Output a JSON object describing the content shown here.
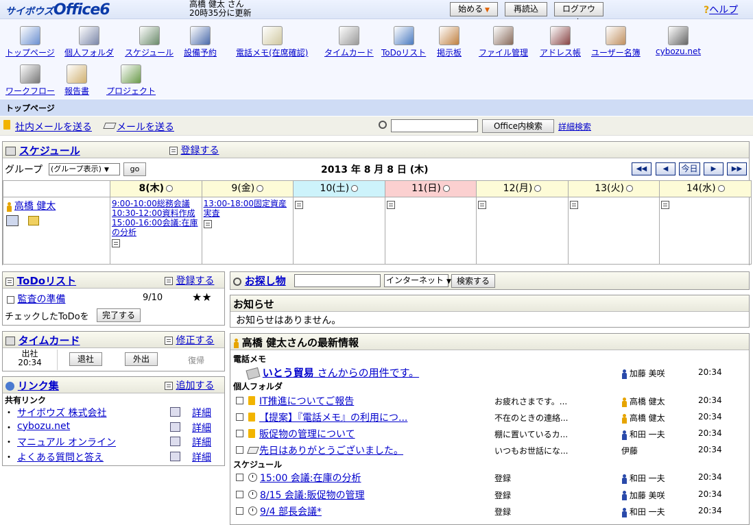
{
  "header": {
    "logo_small": "サイボウズ",
    "logo_big": "Office6",
    "user_name": "高橋 健太 さん",
    "updated": "20時35分に更新",
    "start_btn": "始める",
    "reload_btn": "再読込",
    "logout_btn": "ログアウト",
    "help": "ヘルプ"
  },
  "apps": [
    {
      "label": "トップページ",
      "icon": "top-page-icon"
    },
    {
      "label": "個人フォルダ",
      "icon": "personal-folder-icon"
    },
    {
      "label": "スケジュール",
      "icon": "schedule-icon"
    },
    {
      "label": "設備予約",
      "icon": "facility-icon"
    },
    {
      "label": "電話メモ(在席確認)",
      "icon": "phone-memo-icon"
    },
    {
      "label": "タイムカード",
      "icon": "timecard-icon"
    },
    {
      "label": "ToDoリスト",
      "icon": "todo-icon"
    },
    {
      "label": "掲示板",
      "icon": "bulletin-icon"
    },
    {
      "label": "ファイル管理",
      "icon": "file-management-icon"
    },
    {
      "label": "アドレス帳",
      "icon": "address-book-icon"
    },
    {
      "label": "ユーザー名簿",
      "icon": "user-directory-icon"
    },
    {
      "label": "cybozu.net",
      "icon": "cybozu-net-icon"
    },
    {
      "label": "ワークフロー",
      "icon": "workflow-icon"
    },
    {
      "label": "報告書",
      "icon": "report-icon"
    },
    {
      "label": "プロジェクト",
      "icon": "project-icon"
    }
  ],
  "page_title": "トップページ",
  "toolbar": {
    "internal_mail": "社内メールを送る",
    "send_mail": "メールを送る",
    "search_btn": "Office内検索",
    "detail_search": "詳細検索"
  },
  "schedule": {
    "title": "スケジュール",
    "register": "登録する",
    "group_label": "グループ",
    "group_select": "(グループ表示)",
    "go_btn": "go",
    "date": "2013 年 8 月 8 日 (木)",
    "nav_first": "◀◀",
    "nav_prev": "◀",
    "nav_today": "今日",
    "nav_next": "▶",
    "nav_last": "▶▶",
    "days": [
      {
        "label": "8(木)",
        "bg": "#fdfbd7",
        "bold": true
      },
      {
        "label": "9(金)",
        "bg": "#fdfbd7"
      },
      {
        "label": "10(土)",
        "bg": "#cdf3fb"
      },
      {
        "label": "11(日)",
        "bg": "#fbd0d0"
      },
      {
        "label": "12(月)",
        "bg": "#fdfbd7"
      },
      {
        "label": "13(火)",
        "bg": "#fdfbd7"
      },
      {
        "label": "14(水)",
        "bg": "#fdfbd7"
      }
    ],
    "user": "高橋 健太",
    "events_day1": [
      "9:00-10:00総務会議",
      "10:30-12:00資料作成",
      "15:00-16:00会議:在庫の分析"
    ],
    "events_day2": [
      "13:00-18:00固定資産実査"
    ]
  },
  "todo": {
    "title": "ToDoリスト",
    "register": "登録する",
    "item": "監査の準備",
    "due": "9/10",
    "stars": "★★",
    "checked_label": "チェックしたToDoを",
    "complete_btn": "完了する"
  },
  "timecard": {
    "title": "タイムカード",
    "edit": "修正する",
    "in_label": "出社",
    "in_time": "20:34",
    "out_btn": "退社",
    "away_btn": "外出",
    "return_btn": "復帰"
  },
  "links": {
    "title": "リンク集",
    "add": "追加する",
    "shared": "共有リンク",
    "detail": "詳細",
    "items": [
      "サイボウズ 株式会社",
      "cybozu.net",
      "マニュアル オンライン",
      "よくある質問と答え"
    ]
  },
  "search": {
    "title": "お探し物",
    "select": "インターネット",
    "btn": "検索する"
  },
  "notice": {
    "title": "お知らせ",
    "body": "お知らせはありません。"
  },
  "latest": {
    "title": "高橋 健太さんの最新情報",
    "phone_section": "電話メモ",
    "phone_company": "いとう貿易",
    "phone_text": " さんからの用件です。",
    "phone_from": "加藤 美咲",
    "phone_time": "20:34",
    "folder_section": "個人フォルダ",
    "folder_items": [
      {
        "title": "IT推進についてご報告",
        "excerpt": "お疲れさまです。...",
        "person": "高橋 健太",
        "time": "20:34",
        "color": "orange"
      },
      {
        "title": "【提案】『電話メモ』の利用につ...",
        "excerpt": "不在のときの連絡...",
        "person": "高橋 健太",
        "time": "20:34",
        "color": "orange"
      },
      {
        "title": "販促物の管理について",
        "excerpt": "棚に置いているカ...",
        "person": "和田 一夫",
        "time": "20:34",
        "color": "blue"
      },
      {
        "title": "先日はありがとうございました。",
        "excerpt": "いつもお世話にな...",
        "person": "伊藤",
        "time": "20:34",
        "color": "none"
      }
    ],
    "schedule_section": "スケジュール",
    "schedule_items": [
      {
        "title": "15:00 会議:在庫の分析",
        "status": "登録",
        "person": "和田 一夫",
        "time": "20:34"
      },
      {
        "title": "8/15 会議:販促物の管理",
        "status": "登録",
        "person": "加藤 美咲",
        "time": "20:34"
      },
      {
        "title": "9/4 部長会議*",
        "status": "登録",
        "person": "和田 一夫",
        "time": "20:34"
      }
    ]
  }
}
